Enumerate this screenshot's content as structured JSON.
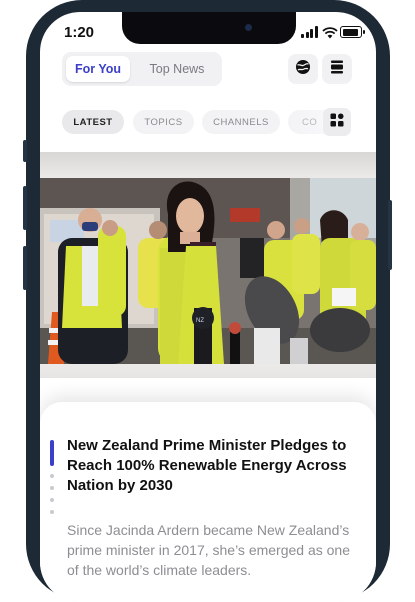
{
  "status": {
    "time": "1:20"
  },
  "tabs": {
    "active": "For You",
    "inactive": "Top News"
  },
  "icons": {
    "globe": "globe-icon",
    "reader": "reader-mode-icon",
    "grid": "grid-icon"
  },
  "chips": [
    "LATEST",
    "TOPICS",
    "CHANNELS",
    "CO"
  ],
  "article": {
    "headline": "New Zealand Prime Minister Pledges to Reach 100% Renewable Energy Across Nation by 2030",
    "excerpt": "Since Jacinda Ardern became New Zealand’s prime minister in 2017, she’s emerged as one of the world’s climate leaders."
  },
  "colors": {
    "accent": "#3b3fc9",
    "frame": "#1d2a36"
  }
}
